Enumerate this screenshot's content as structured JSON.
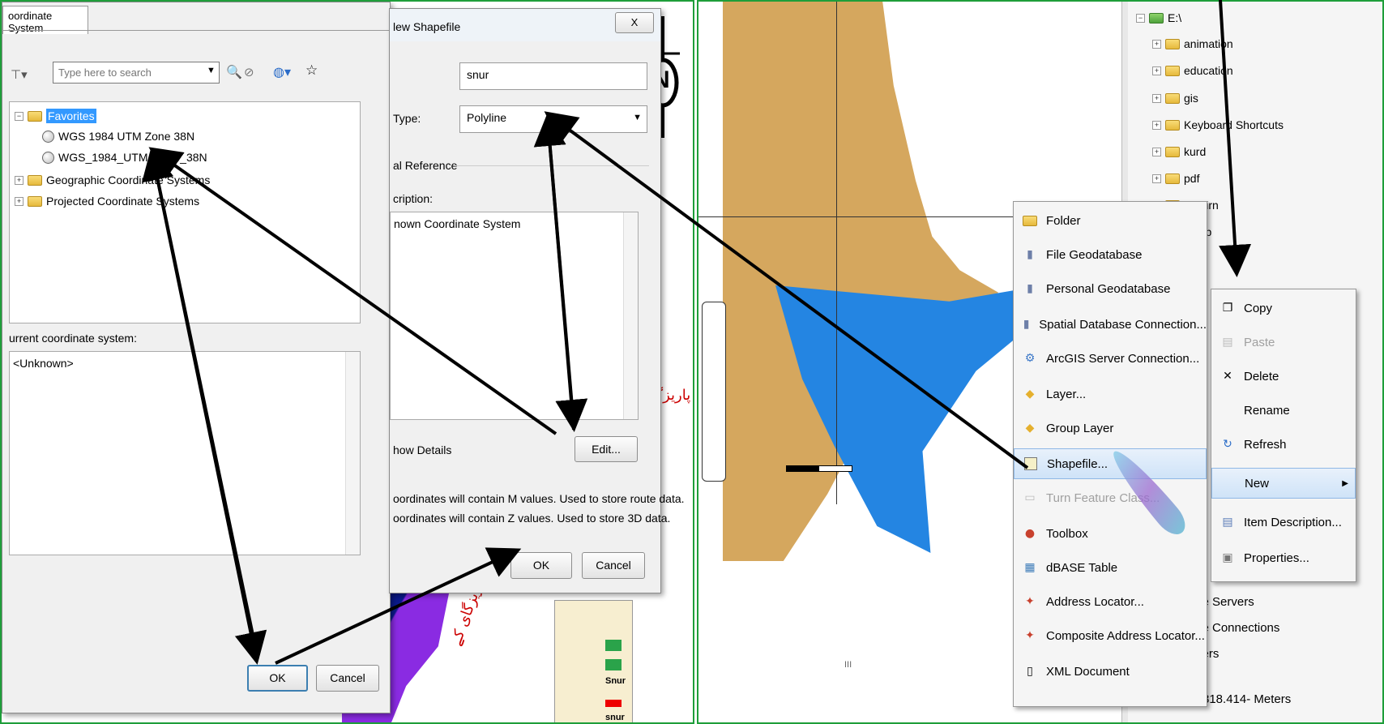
{
  "coord_dialog": {
    "tab": "oordinate System",
    "search_placeholder": "Type here to search",
    "tree": {
      "favorites": "Favorites",
      "fav_item_1": "WGS 1984 UTM Zone 38N",
      "fav_item_2": "WGS_1984_UTM_Zone_38N",
      "geographic": "Geographic Coordinate Systems",
      "projected": "Projected Coordinate Systems"
    },
    "current_label": "urrent coordinate system:",
    "current_value": "<Unknown>",
    "ok": "OK",
    "cancel": "Cancel"
  },
  "shapefile_dialog": {
    "title": "lew Shapefile",
    "close": "X",
    "name_value": "snur",
    "type_label": "Type:",
    "type_value": "Polyline",
    "spatial_ref_label": "al Reference",
    "description_label": "cription:",
    "description_value": "nown Coordinate System",
    "show_details": "how Details",
    "edit": "Edit...",
    "m_values": "oordinates will contain M values. Used to store route data.",
    "z_values": "oordinates will contain Z values. Used to store 3D data.",
    "ok": "OK",
    "cancel": "Cancel"
  },
  "map_left": {
    "north": "N",
    "legend_snur_1": "Snur",
    "legend_snur_2": "snur",
    "persian_1": "پاریزگ",
    "persian_2": "پاریزگای کے"
  },
  "catalog_tree": {
    "root": "E:\\",
    "items": [
      "animation",
      "education",
      "gis",
      "Keyboard Shortcuts",
      "kurd",
      "pdf",
      "sargirn",
      "Temp"
    ],
    "bottom_items": [
      "se Servers",
      "se Connections",
      "vers"
    ],
    "scale": "818.414- Meters",
    "scroll_mark": "III"
  },
  "new_menu": {
    "items": [
      {
        "label": "Folder",
        "icon": "folder-icon"
      },
      {
        "label": "File Geodatabase",
        "icon": "geodatabase-icon"
      },
      {
        "label": "Personal Geodatabase",
        "icon": "geodatabase-icon"
      },
      {
        "label": "Spatial Database Connection...",
        "icon": "database-connection-icon"
      },
      {
        "label": "ArcGIS Server Connection...",
        "icon": "server-icon"
      },
      {
        "label": "Layer...",
        "icon": "layer-icon"
      },
      {
        "label": "Group Layer",
        "icon": "group-layer-icon"
      },
      {
        "label": "Shapefile...",
        "icon": "shapefile-icon"
      },
      {
        "label": "Turn Feature Class...",
        "icon": "feature-class-icon"
      },
      {
        "label": "Toolbox",
        "icon": "toolbox-icon"
      },
      {
        "label": "dBASE Table",
        "icon": "table-icon"
      },
      {
        "label": "Address Locator...",
        "icon": "locator-icon"
      },
      {
        "label": "Composite Address Locator...",
        "icon": "locator-icon"
      },
      {
        "label": "XML Document",
        "icon": "xml-icon"
      }
    ]
  },
  "file_menu": {
    "items": [
      {
        "label": "Copy",
        "icon": "copy-icon"
      },
      {
        "label": "Paste",
        "icon": "paste-icon"
      },
      {
        "label": "Delete",
        "icon": "delete-icon"
      },
      {
        "label": "Rename",
        "icon": ""
      },
      {
        "label": "Refresh",
        "icon": "refresh-icon"
      },
      {
        "label": "New",
        "icon": ""
      },
      {
        "label": "Item Description...",
        "icon": "description-icon"
      },
      {
        "label": "Properties...",
        "icon": "properties-icon"
      }
    ],
    "submenu_arrow": "▶"
  },
  "colors": {
    "panel_border": "#1e9e3a",
    "map_tan": "#d5a75e",
    "map_blue": "#2485e2",
    "highlight": "#cfe3f8"
  }
}
